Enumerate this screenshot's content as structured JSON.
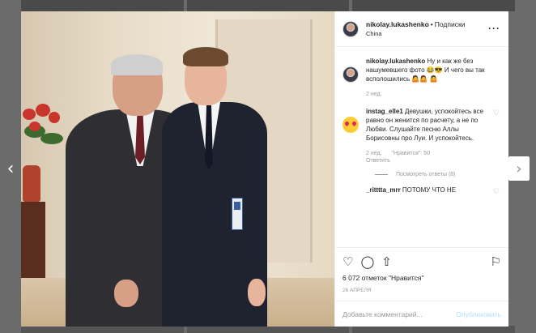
{
  "header": {
    "username": "nikolay.lukashenko",
    "separator": "•",
    "follow_label": "Подписки",
    "location": "China",
    "more_icon": "more-horizontal-icon"
  },
  "comments": [
    {
      "username": "nikolay.lukashenko",
      "text": "Ну и как же без нашумевшего фото 😂😎 И чего вы так всполошились 🤷🤷 🤷",
      "time": "2 нед."
    },
    {
      "username": "instag_elle1",
      "text": "Девушки, успокойтесь все равно он женится по расчету, а не по Любви. Слушайте песню Аллы Борисовны про Луи. И успокойтесь.",
      "time": "2 нед.",
      "likes": "\"Нравится\": 50",
      "reply_label": "Ответить",
      "view_replies": "Посмотреть ответы (8)"
    },
    {
      "username": "_ritttta_mrr",
      "text": "ПОТОМУ ЧТО НЕ"
    }
  ],
  "actions": {
    "like_icon": "heart-icon",
    "comment_icon": "comment-icon",
    "share_icon": "share-icon",
    "save_icon": "bookmark-icon",
    "likes_text": "6 072 отметок \"Нравится\"",
    "date": "26 апреля"
  },
  "add_comment": {
    "placeholder": "Добавьте комментарий...",
    "post_label": "Опубликовать"
  },
  "nav": {
    "prev_icon": "chevron-left-icon",
    "next_icon": "chevron-right-icon"
  }
}
